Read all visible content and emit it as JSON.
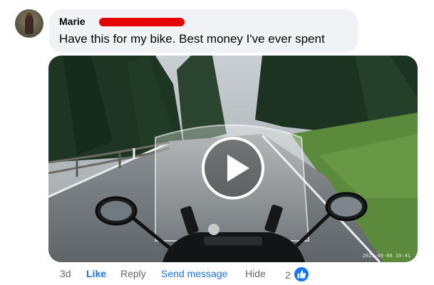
{
  "comment": {
    "author": "Marie",
    "text": "Have this for my bike. Best money I've ever spent",
    "attachment": {
      "type": "video",
      "timestamp_overlay": "2021-06-06 10:41"
    }
  },
  "actions": {
    "time": "3d",
    "like": "Like",
    "reply": "Reply",
    "send_message": "Send message",
    "hide": "Hide"
  },
  "reactions": {
    "count": "2",
    "icon": "thumbs-up-icon"
  },
  "colors": {
    "bubble": "#f0f2f5",
    "link": "#1b74e4",
    "muted": "#65676b",
    "like_badge": "#1877f2",
    "redaction": "#e60000"
  }
}
